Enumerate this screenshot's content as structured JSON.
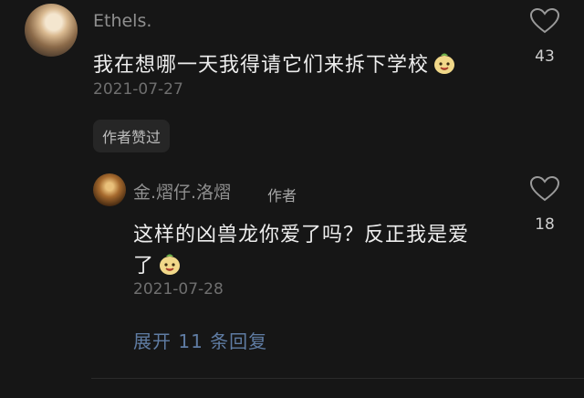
{
  "comments": [
    {
      "username": "Ethels.",
      "text": "我在想哪一天我得请它们来拆下学校",
      "date": "2021-07-27",
      "likes": "43",
      "badge": "作者赞过"
    }
  ],
  "reply": {
    "username": "金.熠仔.洛熠",
    "author_tag": "作者",
    "text_line1": "这样的凶兽龙你爱了吗？反正我是爱",
    "text_line2": "了",
    "date": "2021-07-28",
    "likes": "18"
  },
  "expand_label": "展开 11 条回复",
  "icons": {
    "like": "heart-outline-icon",
    "emoji": "smiling-mascot-emoji-icon"
  },
  "colors": {
    "background": "#161616",
    "username": "#8f8f8f",
    "link": "#5f7ca3"
  }
}
